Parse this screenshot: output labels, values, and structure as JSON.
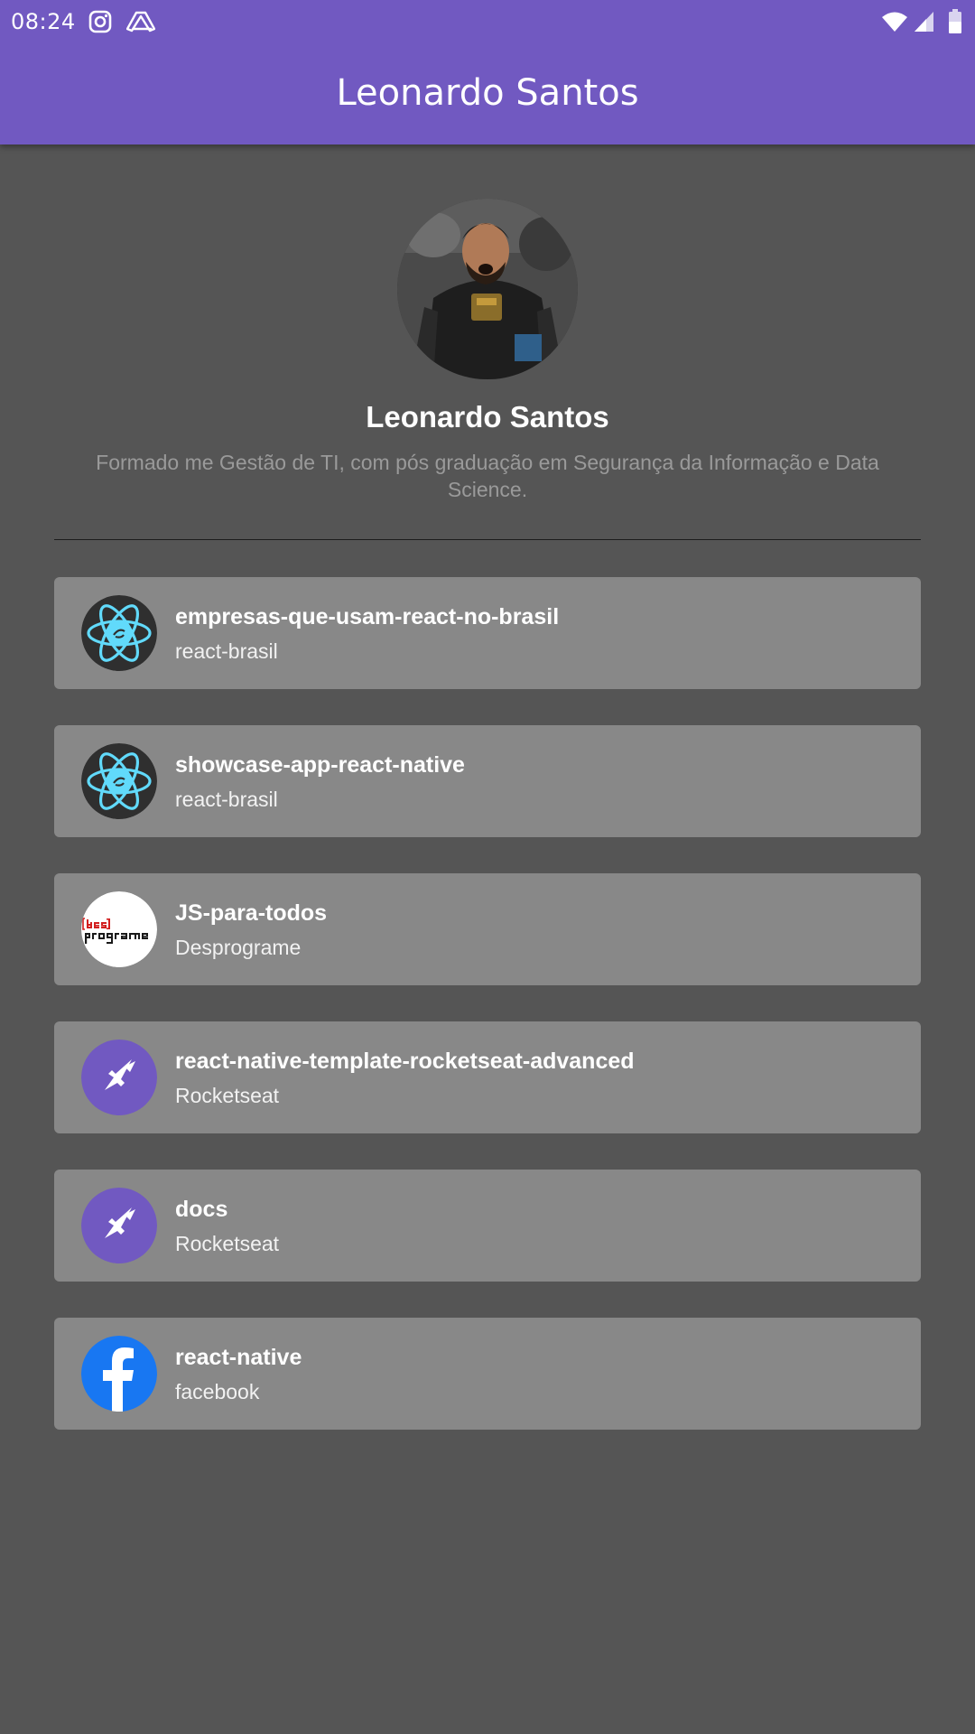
{
  "status_bar": {
    "time": "08:24",
    "icons": [
      "instagram-icon",
      "drive-icon",
      "wifi-icon",
      "signal-icon",
      "battery-icon"
    ]
  },
  "app_bar": {
    "title": "Leonardo Santos",
    "color": "#7159c1"
  },
  "profile": {
    "name": "Leonardo Santos",
    "bio": "Formado me Gestão de TI, com pós graduação em Segurança da Informação e Data Science."
  },
  "repositories": [
    {
      "name": "empresas-que-usam-react-no-brasil",
      "owner": "react-brasil",
      "avatar": "react-logo-icon"
    },
    {
      "name": "showcase-app-react-native",
      "owner": "react-brasil",
      "avatar": "react-logo-icon"
    },
    {
      "name": "JS-para-todos",
      "owner": "Desprograme",
      "avatar": "desprograme-logo-icon"
    },
    {
      "name": "react-native-template-rocketseat-advanced",
      "owner": "Rocketseat",
      "avatar": "rocketseat-logo-icon"
    },
    {
      "name": "docs",
      "owner": "Rocketseat",
      "avatar": "rocketseat-logo-icon"
    },
    {
      "name": "react-native",
      "owner": "facebook",
      "avatar": "facebook-logo-icon"
    }
  ],
  "colors": {
    "background": "#555555",
    "card": "#888888",
    "rocketseat": "#7159c1",
    "facebook": "#1877f2",
    "react": "#61dafb"
  }
}
